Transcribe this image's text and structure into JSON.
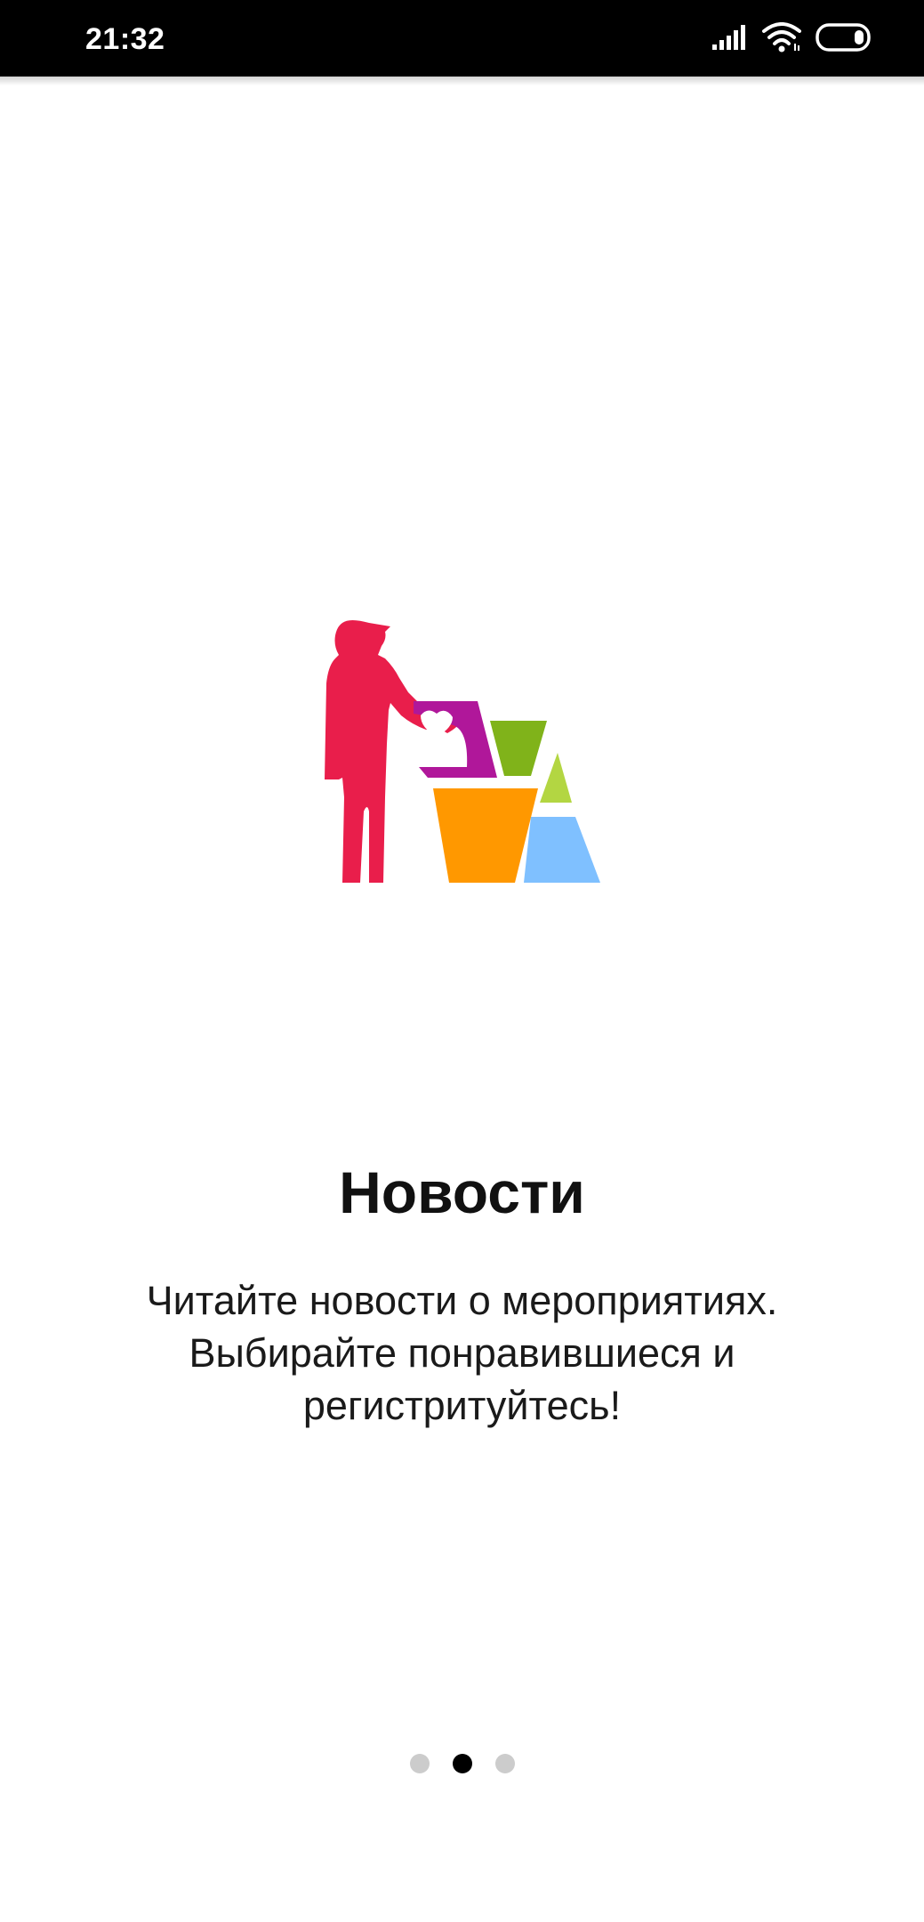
{
  "status_bar": {
    "time": "21:32",
    "icons": [
      "signal-icon",
      "wifi-icon",
      "battery-icon"
    ]
  },
  "onboarding": {
    "illustration": "volunteer-boxes-illustration",
    "title": "Новости",
    "description_lines": [
      "Читайте новости о мероприятиях.",
      "Выбирайте понравившиеся и",
      "регистритуйтесь!"
    ]
  },
  "pager": {
    "total_pages": 3,
    "active_page": 2,
    "active_color": "#000000",
    "inactive_color": "#cccccc"
  },
  "colors": {
    "person": "#e91e4b",
    "purple_box": "#b0179a",
    "green_box": "#80b31a",
    "lime_triangle": "#b3d642",
    "orange_box": "#ff9800",
    "blue_box": "#7fc0ff"
  }
}
